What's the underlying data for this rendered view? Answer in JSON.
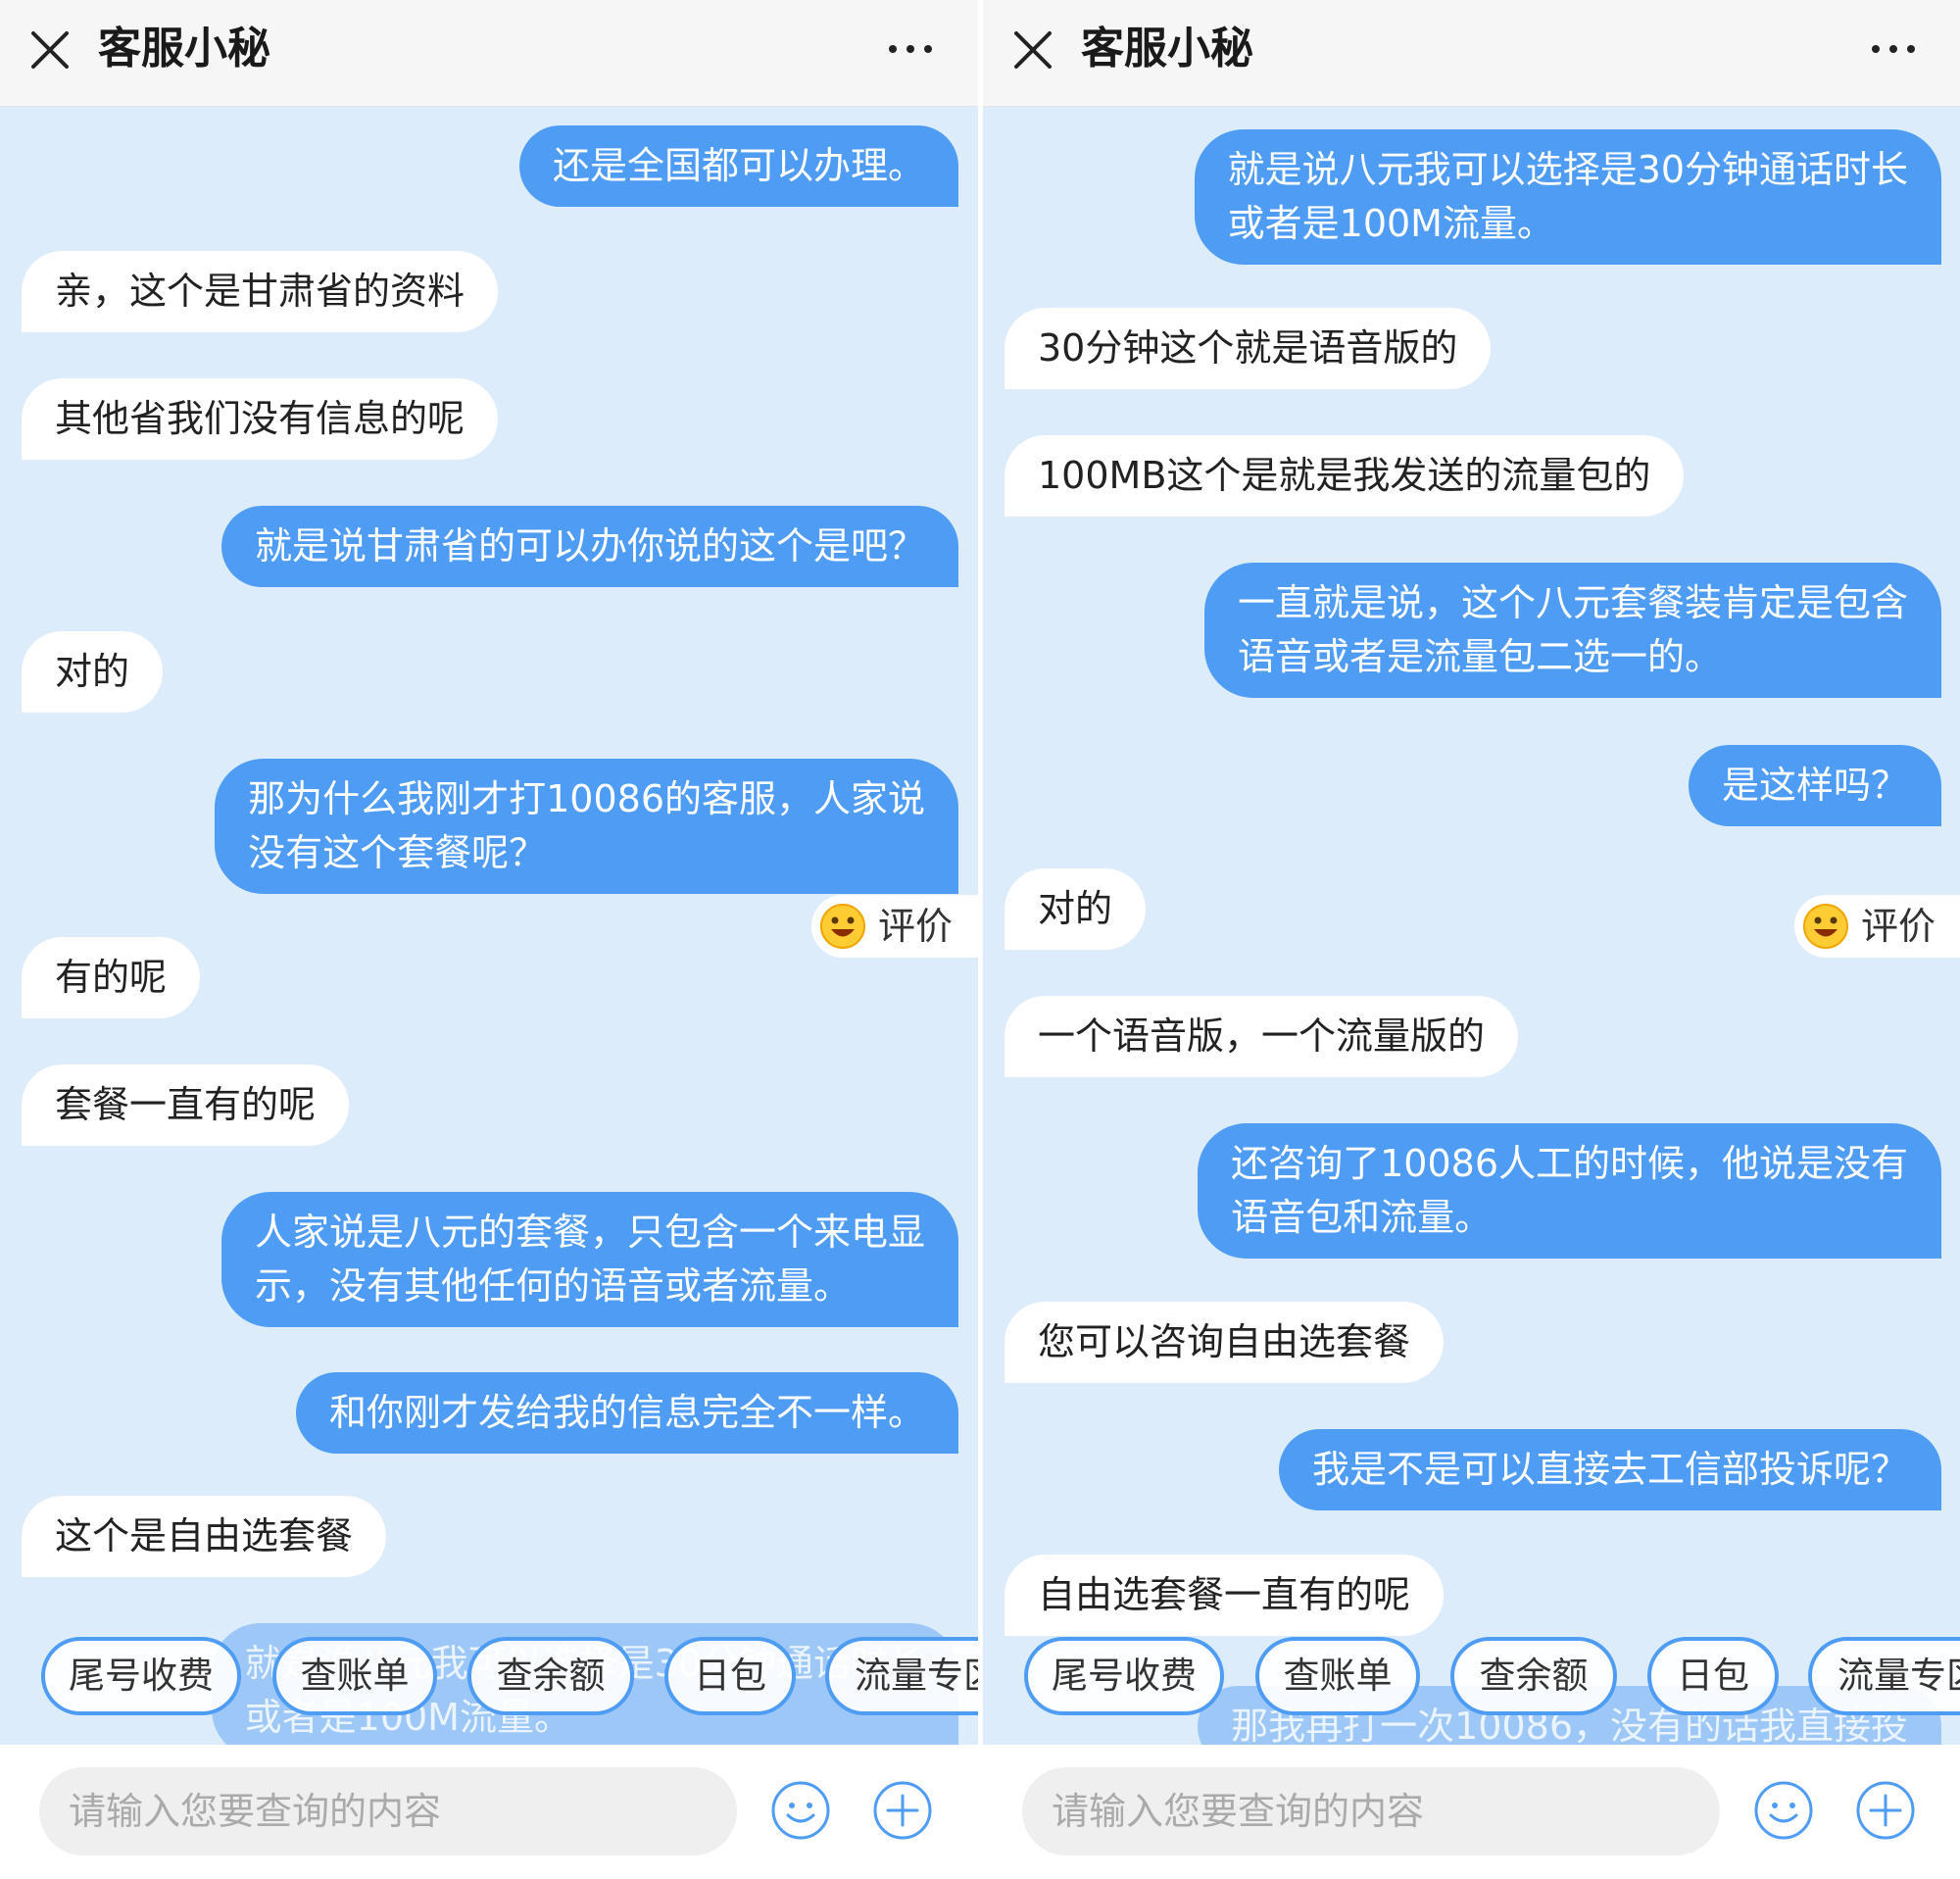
{
  "colors": {
    "accent": "#4f9cf5",
    "chat_background": "#dcecfa",
    "header_background": "#f6f6f6",
    "incoming_bubble": "#ffffff",
    "outgoing_bubble": "#4f9cf5"
  },
  "icons": {
    "close": "close-icon",
    "more": "more-icon",
    "rate": "smile-emoji-icon",
    "emoji": "emoji-icon",
    "add": "plus-icon"
  },
  "left": {
    "header": {
      "title": "客服小秘"
    },
    "messages": [
      {
        "side": "out",
        "text": "还是全国都可以办理。"
      },
      {
        "side": "in",
        "text": "亲，这个是甘肃省的资料"
      },
      {
        "side": "in",
        "text": "其他省我们没有信息的呢"
      },
      {
        "side": "out",
        "text": "就是说甘肃省的可以办你说的这个是吧？"
      },
      {
        "side": "in",
        "text": "对的"
      },
      {
        "side": "out",
        "text": "那为什么我刚才打10086的客服，人家说\n没有这个套餐呢？"
      },
      {
        "side": "in",
        "text": "有的呢"
      },
      {
        "side": "in",
        "text": "套餐一直有的呢"
      },
      {
        "side": "out",
        "text": "人家说是八元的套餐，只包含一个来电显\n示，没有其他任何的语音或者流量。"
      },
      {
        "side": "out",
        "text": "和你刚才发给我的信息完全不一样。"
      },
      {
        "side": "in",
        "text": "这个是自由选套餐"
      },
      {
        "side": "out",
        "text": "就是说八元我可以选择是30分钟通话时长\n或者是100M流量。"
      }
    ],
    "rate_label": "评价",
    "quick_replies": [
      "尾号收费",
      "查账单",
      "查余额",
      "日包",
      "流量专区"
    ],
    "input": {
      "placeholder": "请输入您要查询的内容",
      "value": ""
    }
  },
  "right": {
    "header": {
      "title": "客服小秘"
    },
    "messages": [
      {
        "side": "out",
        "text": "就是说八元我可以选择是30分钟通话时长\n或者是100M流量。"
      },
      {
        "side": "in",
        "text": "30分钟这个就是语音版的"
      },
      {
        "side": "in",
        "text": "100MB这个是就是我发送的流量包的"
      },
      {
        "side": "out",
        "text": "一直就是说，这个八元套餐装肯定是包含\n语音或者是流量包二选一的。"
      },
      {
        "side": "out",
        "text": "是这样吗？"
      },
      {
        "side": "in",
        "text": "对的"
      },
      {
        "side": "in",
        "text": "一个语音版，一个流量版的"
      },
      {
        "side": "out",
        "text": "还咨询了10086人工的时候，他说是没有\n语音包和流量。"
      },
      {
        "side": "in",
        "text": "您可以咨询自由选套餐"
      },
      {
        "side": "out",
        "text": "我是不是可以直接去工信部投诉呢？"
      },
      {
        "side": "in",
        "text": "自由选套餐一直有的呢"
      },
      {
        "side": "out",
        "text": "那我再打一次10086，没有的话我直接投"
      }
    ],
    "rate_label": "评价",
    "quick_replies": [
      "尾号收费",
      "查账单",
      "查余额",
      "日包",
      "流量专区"
    ],
    "input": {
      "placeholder": "请输入您要查询的内容",
      "value": ""
    }
  }
}
